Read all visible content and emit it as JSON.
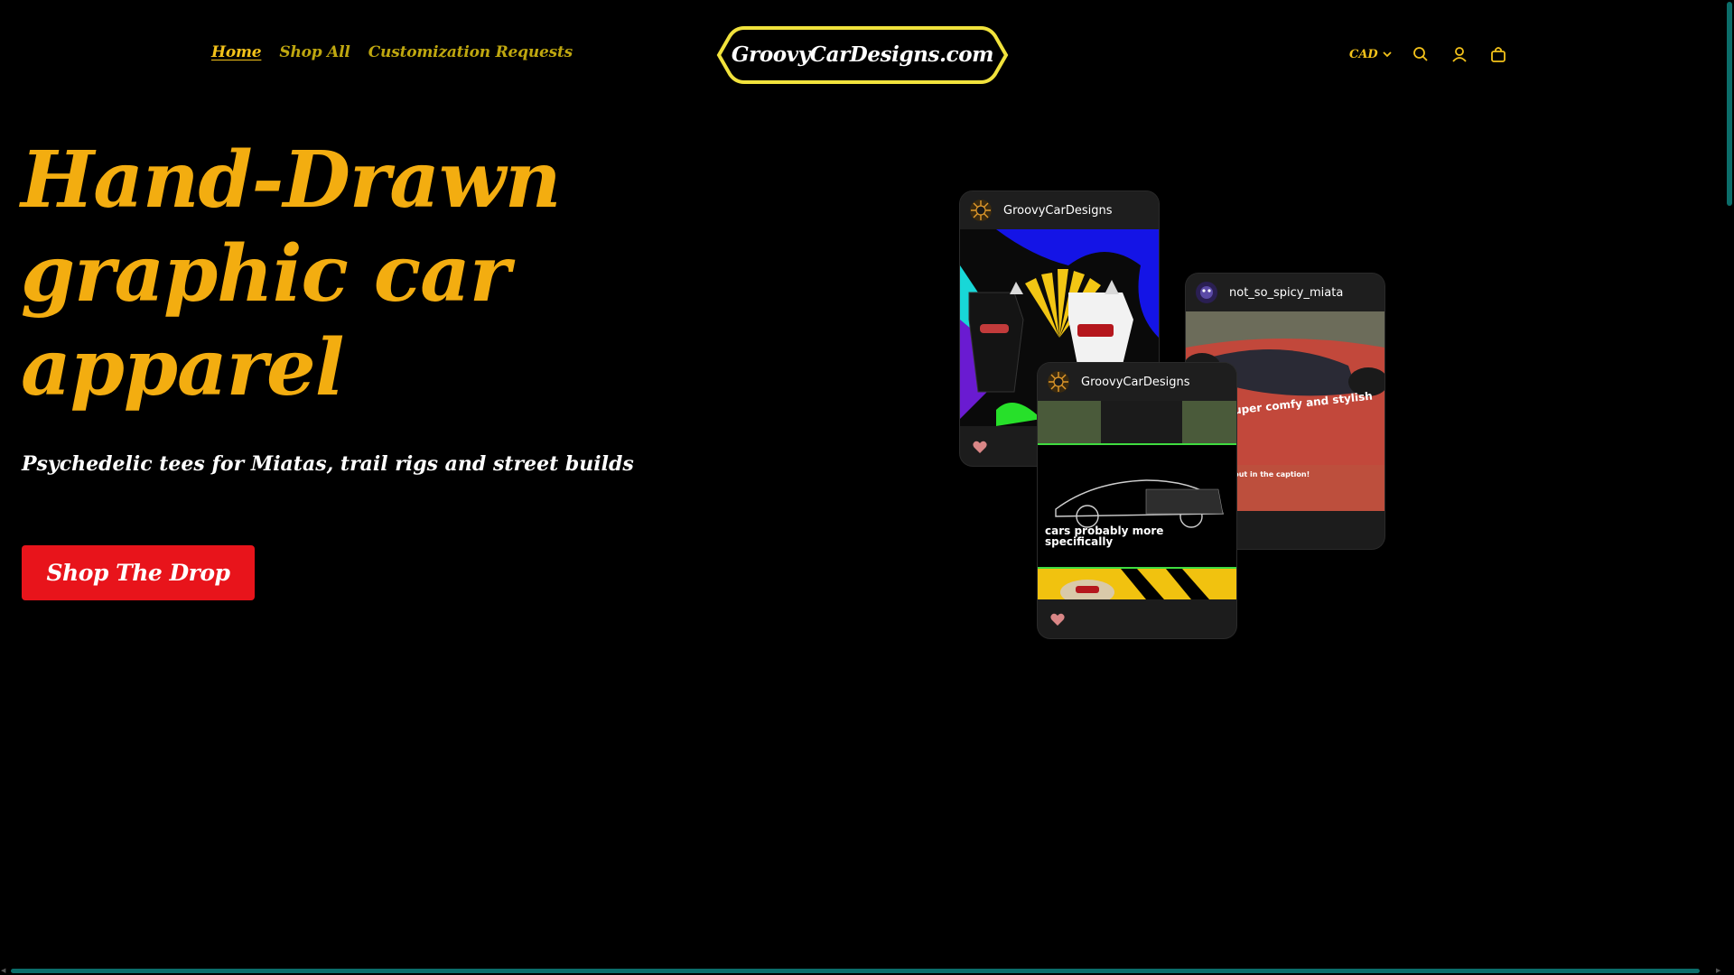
{
  "colors": {
    "accent_yellow": "#f3ad10",
    "nav_yellow": "#bfa70f",
    "cta_red": "#e8141b",
    "scrollbar_teal": "#0b6d6a",
    "background": "#000000"
  },
  "header": {
    "nav": [
      {
        "label": "Home",
        "active": true
      },
      {
        "label": "Shop All",
        "active": false
      },
      {
        "label": "Customization Requests",
        "active": false
      }
    ],
    "logo_text": "GroovyCarDesigns.com",
    "currency": "CAD",
    "icons": [
      "chevron-down-icon",
      "search-icon",
      "account-icon",
      "cart-icon"
    ]
  },
  "hero": {
    "title_lines": [
      "Hand-Drawn",
      "graphic car",
      "apparel"
    ],
    "subtitle": "Psychedelic tees for Miatas, trail rigs and street builds",
    "cta_label": "Shop The Drop"
  },
  "social_cards": [
    {
      "username": "GroovyCarDesigns",
      "icon": "heart-icon"
    },
    {
      "username": "GroovyCarDesigns",
      "overlay": "cars probably more specifically",
      "icon": "heart-icon"
    },
    {
      "username": "not_so_spicy_miata",
      "overlay_main": "Super comfy and stylish",
      "overlay_small": "Check it out in the caption!",
      "icon": "heart-icon"
    }
  ]
}
